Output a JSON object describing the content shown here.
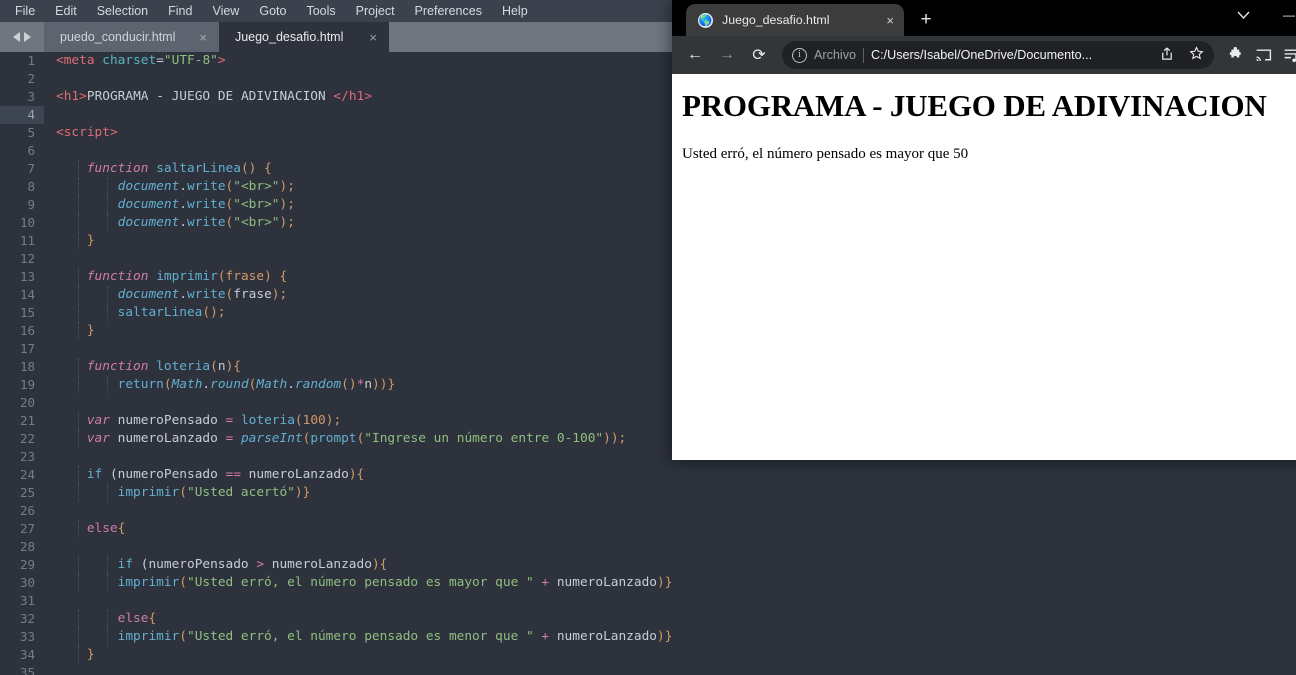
{
  "editor": {
    "menu": [
      "File",
      "Edit",
      "Selection",
      "Find",
      "View",
      "Goto",
      "Tools",
      "Project",
      "Preferences",
      "Help"
    ],
    "tabs": [
      {
        "label": "puedo_conducir.html",
        "close": "×",
        "active": false
      },
      {
        "label": "Juego_desafio.html",
        "close": "×",
        "active": true
      }
    ],
    "active_line": 4,
    "lines": [
      {
        "n": 1,
        "tokens": [
          {
            "t": "<",
            "c": "tag"
          },
          {
            "t": "meta",
            "c": "tag"
          },
          {
            "t": " ",
            "c": "plain"
          },
          {
            "t": "charset",
            "c": "attr"
          },
          {
            "t": "=",
            "c": "plain"
          },
          {
            "t": "\"UTF-8\"",
            "c": "str"
          },
          {
            "t": ">",
            "c": "tag"
          }
        ]
      },
      {
        "n": 2,
        "tokens": []
      },
      {
        "n": 3,
        "tokens": [
          {
            "t": "<",
            "c": "tag"
          },
          {
            "t": "h1",
            "c": "tag"
          },
          {
            "t": ">",
            "c": "tag"
          },
          {
            "t": "PROGRAMA - JUEGO DE ADIVINACION ",
            "c": "plain"
          },
          {
            "t": "</",
            "c": "tag"
          },
          {
            "t": "h1",
            "c": "tag"
          },
          {
            "t": ">",
            "c": "tag"
          }
        ]
      },
      {
        "n": 4,
        "tokens": []
      },
      {
        "n": 5,
        "tokens": [
          {
            "t": "<",
            "c": "tag"
          },
          {
            "t": "script",
            "c": "tag"
          },
          {
            "t": ">",
            "c": "tag"
          }
        ]
      },
      {
        "n": 6,
        "tokens": []
      },
      {
        "n": 7,
        "indent": 1,
        "tokens": [
          {
            "t": "    ",
            "c": "plain"
          },
          {
            "t": "function",
            "c": "kw"
          },
          {
            "t": " ",
            "c": "plain"
          },
          {
            "t": "saltarLinea",
            "c": "fn"
          },
          {
            "t": "() {",
            "c": "punc"
          }
        ]
      },
      {
        "n": 8,
        "indent": 2,
        "tokens": [
          {
            "t": "        ",
            "c": "plain"
          },
          {
            "t": "document",
            "c": "obj"
          },
          {
            "t": ".",
            "c": "plain"
          },
          {
            "t": "write",
            "c": "fn"
          },
          {
            "t": "(",
            "c": "punc"
          },
          {
            "t": "\"<br>\"",
            "c": "str"
          },
          {
            "t": ");",
            "c": "punc"
          }
        ]
      },
      {
        "n": 9,
        "indent": 2,
        "tokens": [
          {
            "t": "        ",
            "c": "plain"
          },
          {
            "t": "document",
            "c": "obj"
          },
          {
            "t": ".",
            "c": "plain"
          },
          {
            "t": "write",
            "c": "fn"
          },
          {
            "t": "(",
            "c": "punc"
          },
          {
            "t": "\"<br>\"",
            "c": "str"
          },
          {
            "t": ");",
            "c": "punc"
          }
        ]
      },
      {
        "n": 10,
        "indent": 2,
        "tokens": [
          {
            "t": "        ",
            "c": "plain"
          },
          {
            "t": "document",
            "c": "obj"
          },
          {
            "t": ".",
            "c": "plain"
          },
          {
            "t": "write",
            "c": "fn"
          },
          {
            "t": "(",
            "c": "punc"
          },
          {
            "t": "\"<br>\"",
            "c": "str"
          },
          {
            "t": ");",
            "c": "punc"
          }
        ]
      },
      {
        "n": 11,
        "indent": 1,
        "tokens": [
          {
            "t": "    ",
            "c": "plain"
          },
          {
            "t": "}",
            "c": "punc"
          }
        ]
      },
      {
        "n": 12,
        "tokens": []
      },
      {
        "n": 13,
        "indent": 1,
        "tokens": [
          {
            "t": "    ",
            "c": "plain"
          },
          {
            "t": "function",
            "c": "kw"
          },
          {
            "t": " ",
            "c": "plain"
          },
          {
            "t": "imprimir",
            "c": "fn"
          },
          {
            "t": "(",
            "c": "punc"
          },
          {
            "t": "frase",
            "c": "param"
          },
          {
            "t": ") {",
            "c": "punc"
          }
        ]
      },
      {
        "n": 14,
        "indent": 2,
        "tokens": [
          {
            "t": "        ",
            "c": "plain"
          },
          {
            "t": "document",
            "c": "obj"
          },
          {
            "t": ".",
            "c": "plain"
          },
          {
            "t": "write",
            "c": "fn"
          },
          {
            "t": "(",
            "c": "punc"
          },
          {
            "t": "frase",
            "c": "plain"
          },
          {
            "t": ");",
            "c": "punc"
          }
        ]
      },
      {
        "n": 15,
        "indent": 2,
        "tokens": [
          {
            "t": "        ",
            "c": "plain"
          },
          {
            "t": "saltarLinea",
            "c": "fn"
          },
          {
            "t": "();",
            "c": "punc"
          }
        ]
      },
      {
        "n": 16,
        "indent": 1,
        "tokens": [
          {
            "t": "    ",
            "c": "plain"
          },
          {
            "t": "}",
            "c": "punc"
          }
        ]
      },
      {
        "n": 17,
        "tokens": []
      },
      {
        "n": 18,
        "indent": 1,
        "tokens": [
          {
            "t": "    ",
            "c": "plain"
          },
          {
            "t": "function",
            "c": "kw"
          },
          {
            "t": " ",
            "c": "plain"
          },
          {
            "t": "loteria",
            "c": "fn"
          },
          {
            "t": "(",
            "c": "punc"
          },
          {
            "t": "n",
            "c": "plain"
          },
          {
            "t": "){",
            "c": "punc"
          }
        ]
      },
      {
        "n": 19,
        "indent": 2,
        "tokens": [
          {
            "t": "        ",
            "c": "plain"
          },
          {
            "t": "return",
            "c": "fn"
          },
          {
            "t": "(",
            "c": "punc"
          },
          {
            "t": "Math",
            "c": "obj"
          },
          {
            "t": ".",
            "c": "plain"
          },
          {
            "t": "round",
            "c": "obj"
          },
          {
            "t": "(",
            "c": "punc"
          },
          {
            "t": "Math",
            "c": "obj"
          },
          {
            "t": ".",
            "c": "plain"
          },
          {
            "t": "random",
            "c": "obj"
          },
          {
            "t": "()",
            "c": "punc"
          },
          {
            "t": "*",
            "c": "op"
          },
          {
            "t": "n",
            "c": "plain"
          },
          {
            "t": "))}",
            "c": "punc"
          }
        ]
      },
      {
        "n": 20,
        "tokens": []
      },
      {
        "n": 21,
        "indent": 1,
        "tokens": [
          {
            "t": "    ",
            "c": "plain"
          },
          {
            "t": "var",
            "c": "kw"
          },
          {
            "t": " numeroPensado ",
            "c": "plain"
          },
          {
            "t": "=",
            "c": "op"
          },
          {
            "t": " ",
            "c": "plain"
          },
          {
            "t": "loteria",
            "c": "fn"
          },
          {
            "t": "(",
            "c": "punc"
          },
          {
            "t": "100",
            "c": "num"
          },
          {
            "t": ");",
            "c": "punc"
          }
        ]
      },
      {
        "n": 22,
        "indent": 1,
        "tokens": [
          {
            "t": "    ",
            "c": "plain"
          },
          {
            "t": "var",
            "c": "kw"
          },
          {
            "t": " numeroLanzado ",
            "c": "plain"
          },
          {
            "t": "=",
            "c": "op"
          },
          {
            "t": " ",
            "c": "plain"
          },
          {
            "t": "parseInt",
            "c": "obj"
          },
          {
            "t": "(",
            "c": "punc"
          },
          {
            "t": "prompt",
            "c": "fn"
          },
          {
            "t": "(",
            "c": "punc"
          },
          {
            "t": "\"Ingrese un número entre 0-100\"",
            "c": "str"
          },
          {
            "t": "));",
            "c": "punc"
          }
        ]
      },
      {
        "n": 23,
        "tokens": []
      },
      {
        "n": 24,
        "indent": 1,
        "tokens": [
          {
            "t": "    ",
            "c": "plain"
          },
          {
            "t": "if",
            "c": "fn"
          },
          {
            "t": " (numeroPensado ",
            "c": "plain"
          },
          {
            "t": "==",
            "c": "op"
          },
          {
            "t": " numeroLanzado",
            "c": "plain"
          },
          {
            "t": "){",
            "c": "punc"
          }
        ]
      },
      {
        "n": 25,
        "indent": 2,
        "tokens": [
          {
            "t": "        ",
            "c": "plain"
          },
          {
            "t": "imprimir",
            "c": "fn"
          },
          {
            "t": "(",
            "c": "punc"
          },
          {
            "t": "\"Usted acertó\"",
            "c": "str"
          },
          {
            "t": ")}",
            "c": "punc"
          }
        ]
      },
      {
        "n": 26,
        "tokens": []
      },
      {
        "n": 27,
        "indent": 1,
        "tokens": [
          {
            "t": "    ",
            "c": "plain"
          },
          {
            "t": "else",
            "c": "kw2"
          },
          {
            "t": "{",
            "c": "punc"
          }
        ]
      },
      {
        "n": 28,
        "tokens": []
      },
      {
        "n": 29,
        "indent": 2,
        "tokens": [
          {
            "t": "        ",
            "c": "plain"
          },
          {
            "t": "if",
            "c": "fn"
          },
          {
            "t": " (numeroPensado ",
            "c": "plain"
          },
          {
            "t": ">",
            "c": "op"
          },
          {
            "t": " numeroLanzado",
            "c": "plain"
          },
          {
            "t": "){",
            "c": "punc"
          }
        ]
      },
      {
        "n": 30,
        "indent": 2,
        "tokens": [
          {
            "t": "        ",
            "c": "plain"
          },
          {
            "t": "imprimir",
            "c": "fn"
          },
          {
            "t": "(",
            "c": "punc"
          },
          {
            "t": "\"Usted erró, el número pensado es mayor que \"",
            "c": "str"
          },
          {
            "t": " ",
            "c": "plain"
          },
          {
            "t": "+",
            "c": "op"
          },
          {
            "t": " numeroLanzado",
            "c": "plain"
          },
          {
            "t": ")}",
            "c": "punc"
          }
        ]
      },
      {
        "n": 31,
        "tokens": []
      },
      {
        "n": 32,
        "indent": 2,
        "tokens": [
          {
            "t": "        ",
            "c": "plain"
          },
          {
            "t": "else",
            "c": "kw2"
          },
          {
            "t": "{",
            "c": "punc"
          }
        ]
      },
      {
        "n": 33,
        "indent": 2,
        "tokens": [
          {
            "t": "        ",
            "c": "plain"
          },
          {
            "t": "imprimir",
            "c": "fn"
          },
          {
            "t": "(",
            "c": "punc"
          },
          {
            "t": "\"Usted erró, el número pensado es menor que \"",
            "c": "str"
          },
          {
            "t": " ",
            "c": "plain"
          },
          {
            "t": "+",
            "c": "op"
          },
          {
            "t": " numeroLanzado",
            "c": "plain"
          },
          {
            "t": ")}",
            "c": "punc"
          }
        ]
      },
      {
        "n": 34,
        "indent": 1,
        "tokens": [
          {
            "t": "    ",
            "c": "plain"
          },
          {
            "t": "}",
            "c": "punc"
          }
        ]
      },
      {
        "n": 35,
        "tokens": []
      }
    ]
  },
  "browser": {
    "tab": {
      "title": "Juego_desafio.html",
      "close": "×",
      "favicon": "globe-icon"
    },
    "new_tab": "+",
    "window_controls": {
      "minimize": "—",
      "chevron": "⌄"
    },
    "toolbar": {
      "back": "←",
      "forward": "→",
      "reload": "⟳",
      "scheme_label": "Archivo",
      "url": "C:/Users/Isabel/OneDrive/Documento...",
      "share_icon": "share-icon",
      "bookmark_icon": "star-icon",
      "extensions_icon": "puzzle-icon",
      "cast_icon": "cast-icon",
      "readinglist_icon": "reading-list-icon"
    },
    "page": {
      "heading": "PROGRAMA - JUEGO DE ADIVINACION",
      "message": "Usted erró, el número pensado es mayor que 50"
    }
  }
}
